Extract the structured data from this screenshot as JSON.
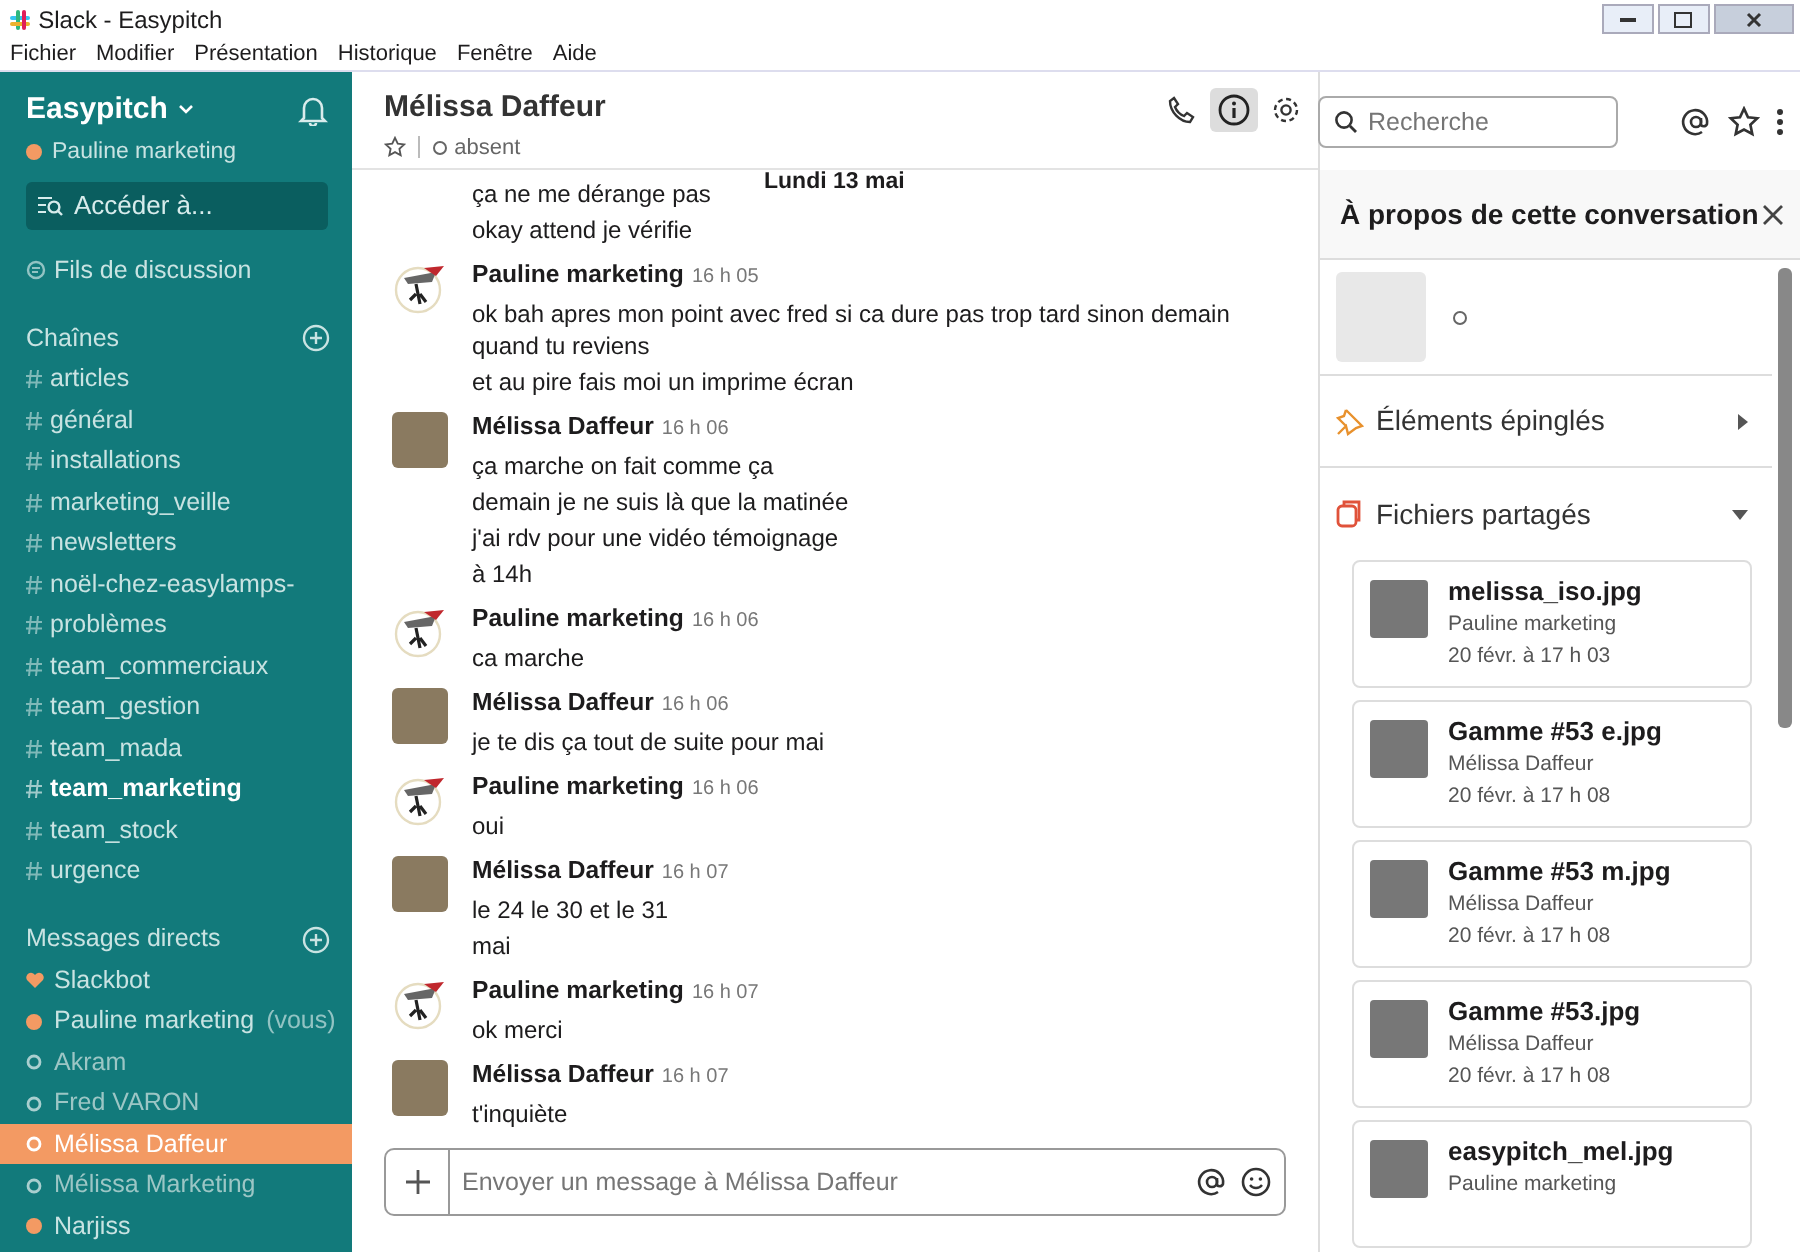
{
  "window": {
    "title": "Slack - Easypitch"
  },
  "menu": [
    "Fichier",
    "Modifier",
    "Présentation",
    "Historique",
    "Fenêtre",
    "Aide"
  ],
  "sidebar": {
    "workspace": "Easypitch",
    "user": "Pauline marketing",
    "jump": "Accéder à...",
    "threads": "Fils de discussion",
    "channels_title": "Chaînes",
    "channels": [
      {
        "name": "articles",
        "unread": false
      },
      {
        "name": "général",
        "unread": false
      },
      {
        "name": "installations",
        "unread": false
      },
      {
        "name": "marketing_veille",
        "unread": false
      },
      {
        "name": "newsletters",
        "unread": false
      },
      {
        "name": "noël-chez-easylamps-",
        "unread": false
      },
      {
        "name": "problèmes",
        "unread": false
      },
      {
        "name": "team_commerciaux",
        "unread": false
      },
      {
        "name": "team_gestion",
        "unread": false
      },
      {
        "name": "team_mada",
        "unread": false
      },
      {
        "name": "team_marketing",
        "unread": true
      },
      {
        "name": "team_stock",
        "unread": false
      },
      {
        "name": "urgence",
        "unread": false
      }
    ],
    "dm_title": "Messages directs",
    "dms": [
      {
        "name": "Slackbot",
        "kind": "bot",
        "selected": false
      },
      {
        "name": "Pauline marketing",
        "suffix": "(vous)",
        "kind": "online",
        "selected": false
      },
      {
        "name": "Akram",
        "kind": "away",
        "selected": false
      },
      {
        "name": "Fred VARON",
        "kind": "away",
        "selected": false
      },
      {
        "name": "Mélissa Daffeur",
        "kind": "away",
        "selected": true
      },
      {
        "name": "Mélissa Marketing",
        "kind": "away",
        "selected": false
      },
      {
        "name": "Narjiss",
        "kind": "online",
        "selected": false
      }
    ]
  },
  "conversation": {
    "name": "Mélissa Daffeur",
    "status": "absent",
    "date": "Lundi 13 mai",
    "messages": [
      {
        "lines": [
          "ça ne me dérange pas",
          "okay attend je vérifie"
        ]
      },
      {
        "author": "Pauline marketing",
        "kind": "logo",
        "time": "16 h 05",
        "lines": [
          "ok bah apres mon point avec fred si ca dure pas trop tard sinon demain quand tu reviens",
          "et au pire fais moi un imprime écran"
        ]
      },
      {
        "author": "Mélissa Daffeur",
        "kind": "photo",
        "time": "16 h 06",
        "lines": [
          "ça marche on fait comme ça",
          "demain je ne suis là que la matinée",
          "j'ai rdv pour une vidéo témoignage",
          "à 14h"
        ]
      },
      {
        "author": "Pauline marketing",
        "kind": "logo",
        "time": "16 h 06",
        "lines": [
          "ca marche"
        ]
      },
      {
        "author": "Mélissa Daffeur",
        "kind": "photo",
        "time": "16 h 06",
        "lines": [
          "je te dis ça tout de suite pour mai"
        ]
      },
      {
        "author": "Pauline marketing",
        "kind": "logo",
        "time": "16 h 06",
        "lines": [
          "oui"
        ]
      },
      {
        "author": "Mélissa Daffeur",
        "kind": "photo",
        "time": "16 h 07",
        "lines": [
          "le 24 le 30 et le 31",
          "mai"
        ]
      },
      {
        "author": "Pauline marketing",
        "kind": "logo",
        "time": "16 h 07",
        "lines": [
          "ok merci"
        ]
      },
      {
        "author": "Mélissa Daffeur",
        "kind": "photo",
        "time": "16 h 07",
        "lines": [
          "t'inquiète"
        ]
      }
    ],
    "composer": {
      "placeholder": "Envoyer un message à Mélissa Daffeur"
    }
  },
  "search": {
    "placeholder": "Recherche"
  },
  "details": {
    "title": "À propos de cette conversation",
    "sections": [
      {
        "label": "Éléments épinglés",
        "expanded": false
      },
      {
        "label": "Fichiers partagés",
        "expanded": true
      }
    ],
    "files": [
      {
        "name": "melissa_iso.jpg",
        "author": "Pauline marketing",
        "date": "20 févr. à 17 h 03"
      },
      {
        "name": "Gamme #53 e.jpg",
        "author": "Mélissa Daffeur",
        "date": "20 févr. à 17 h 08"
      },
      {
        "name": "Gamme #53 m.jpg",
        "author": "Mélissa Daffeur",
        "date": "20 févr. à 17 h 08"
      },
      {
        "name": "Gamme #53.jpg",
        "author": "Mélissa Daffeur",
        "date": "20 févr. à 17 h 08"
      },
      {
        "name": "easypitch_mel.jpg",
        "author": "Pauline marketing"
      }
    ]
  }
}
